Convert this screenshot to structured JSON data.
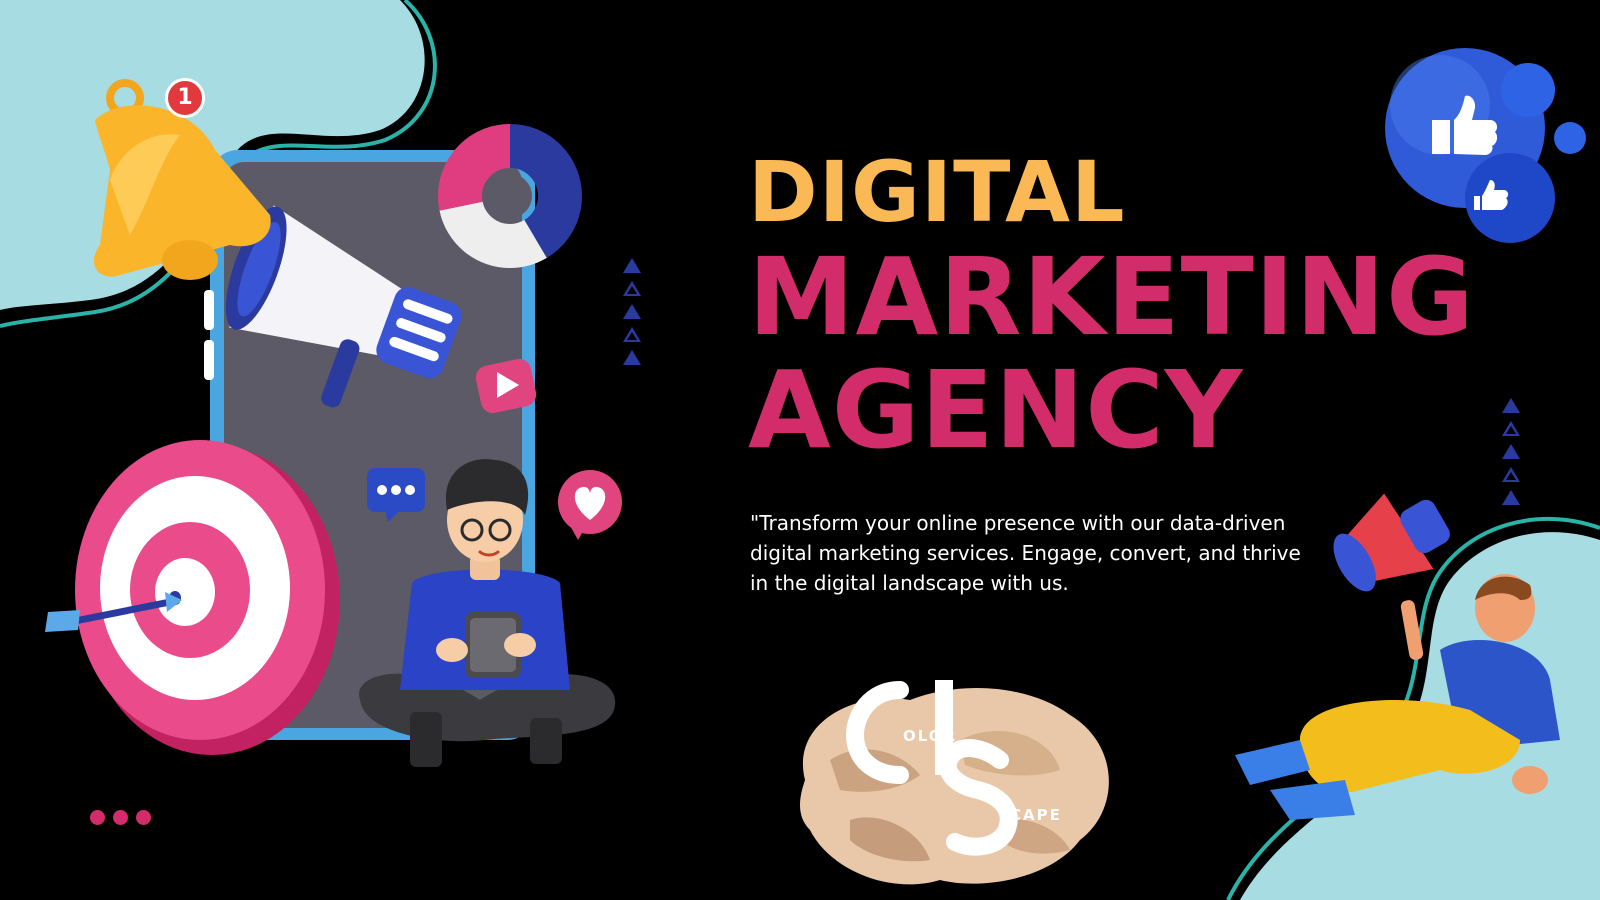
{
  "headline": {
    "line1": "DIGITAL",
    "line2": "MARKETING",
    "line3": "AGENCY"
  },
  "tagline": "\"Transform your online presence with our data-driven digital marketing services. Engage, convert, and thrive in the digital landscape with us.",
  "notification": {
    "count": "1"
  },
  "logo": {
    "part1": "OLOR",
    "part2": "CAPE"
  },
  "colors": {
    "background": "#000000",
    "headline_yellow": "#fbb955",
    "headline_pink": "#d22d6a",
    "accent_teal": "#a6dce2",
    "accent_blue": "#2b3a9e",
    "tagline_white": "#ffffff"
  },
  "icons": [
    "notification-bell-icon",
    "megaphone-icon",
    "donut-chart-icon",
    "play-icon",
    "chat-dots-icon",
    "heart-icon",
    "target-icon",
    "arrow-icon",
    "thumbs-up-icon",
    "phone-icon"
  ]
}
